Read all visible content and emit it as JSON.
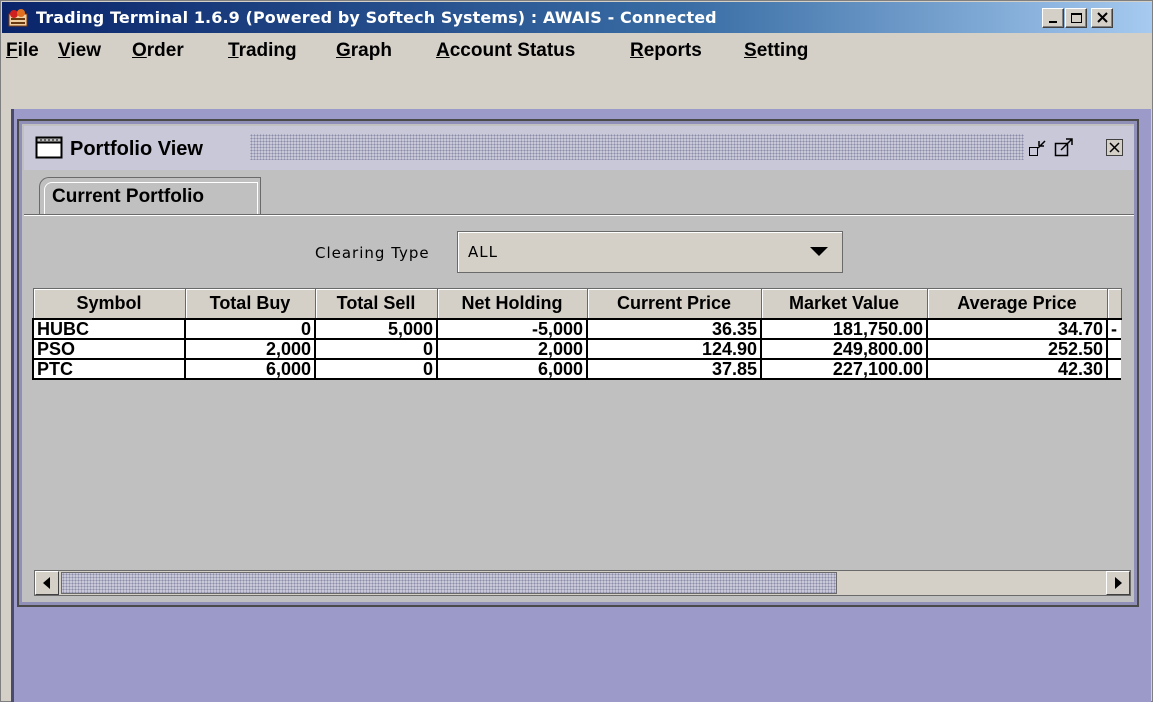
{
  "window": {
    "title": "Trading Terminal 1.6.9 (Powered by Softech Systems)  :  AWAIS - Connected",
    "controls": [
      "minimize-icon",
      "maximize-icon",
      "close-icon"
    ]
  },
  "menubar": {
    "items": [
      {
        "mnemonic": "F",
        "rest": "ile"
      },
      {
        "mnemonic": "V",
        "rest": "iew"
      },
      {
        "mnemonic": "O",
        "rest": "rder"
      },
      {
        "mnemonic": "T",
        "rest": "rading"
      },
      {
        "mnemonic": "G",
        "rest": "raph"
      },
      {
        "mnemonic": "A",
        "rest": "ccount Status"
      },
      {
        "mnemonic": "R",
        "rest": "eports"
      },
      {
        "mnemonic": "S",
        "rest": "etting"
      }
    ]
  },
  "portfolio_frame": {
    "title": "Portfolio View",
    "controls": [
      "restore-icon",
      "maximize-icon",
      "close-icon"
    ],
    "tab": {
      "label": "Current Portfolio"
    },
    "clearing_type": {
      "label": "Clearing Type",
      "value": "ALL"
    },
    "table": {
      "columns": [
        "Symbol",
        "Total Buy",
        "Total Sell",
        "Net Holding",
        "Current Price",
        "Market Value",
        "Average Price"
      ],
      "rows": [
        {
          "symbol": "HUBC",
          "total_buy": "0",
          "total_sell": "5,000",
          "net_holding": "-5,000",
          "current_price": "36.35",
          "market_value": "181,750.00",
          "average_price": "34.70",
          "overflow": "-"
        },
        {
          "symbol": "PSO",
          "total_buy": "2,000",
          "total_sell": "0",
          "net_holding": "2,000",
          "current_price": "124.90",
          "market_value": "249,800.00",
          "average_price": "252.50",
          "overflow": ""
        },
        {
          "symbol": "PTC",
          "total_buy": "6,000",
          "total_sell": "0",
          "net_holding": "6,000",
          "current_price": "37.85",
          "market_value": "227,100.00",
          "average_price": "42.30",
          "overflow": ""
        }
      ]
    },
    "scrollbar": {
      "left_icon": "arrow-left-icon",
      "right_icon": "arrow-right-icon"
    }
  },
  "colors": {
    "titlebar_start": "#0a246a",
    "titlebar_end": "#a6caf0",
    "desktop": "#9c9ac8",
    "frame_border": "#8f8fb8"
  }
}
